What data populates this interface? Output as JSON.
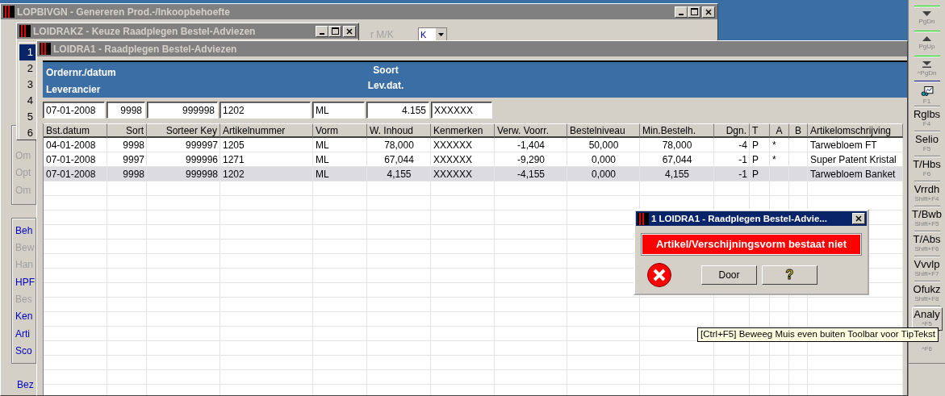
{
  "background_window": {
    "title": "LOPBIVGN - Genereren Prod.-/Inkoopbehoefte",
    "mk_label": "r M/K",
    "mk_value": "K",
    "group_1": [
      {
        "label": "Om",
        "disabled": true
      },
      {
        "label": "Opt",
        "disabled": true
      },
      {
        "label": "Om",
        "disabled": true
      }
    ],
    "group_2": [
      {
        "label": "Beh",
        "disabled": false
      },
      {
        "label": "Bew",
        "disabled": true
      },
      {
        "label": "Han",
        "disabled": true
      },
      {
        "label": "HPF",
        "disabled": false
      },
      {
        "label": "Bes",
        "disabled": true
      },
      {
        "label": "Ken",
        "disabled": false
      },
      {
        "label": "Arti",
        "disabled": false
      },
      {
        "label": "Sco",
        "disabled": false
      }
    ],
    "footer_link": {
      "label": "Bez",
      "disabled": false
    }
  },
  "choice_window": {
    "title": "LOIDRAKZ - Keuze Raadplegen Bestel-Adviezen",
    "items": [
      {
        "label": "1",
        "selected": true
      },
      {
        "label": "2",
        "selected": false
      },
      {
        "label": "3",
        "selected": false
      },
      {
        "label": "4",
        "selected": false
      },
      {
        "label": "5",
        "selected": false
      },
      {
        "label": "6",
        "selected": false
      }
    ]
  },
  "main_window": {
    "title": "LOIDRA1 - Raadplegen Bestel-Adviezen",
    "header": {
      "left": [
        "Ordernr./datum",
        "Leverancier"
      ],
      "center": [
        "Soort",
        "Lev.dat."
      ]
    },
    "filter": [
      "07-01-2008",
      "9998",
      "999998",
      "1202",
      "ML",
      "4.155",
      "XXXXXX"
    ],
    "table": {
      "columns": [
        "Bst.datum",
        "Sort",
        "Sorteer Key",
        "Artikelnummer",
        "Vorm",
        "W. Inhoud",
        "Kenmerken",
        "Verw. Voorr.",
        "Bestelniveau",
        "Min.Bestelh.",
        "Dgn.",
        "T",
        "A",
        "B",
        "Artikelomschrijving"
      ],
      "rows": [
        {
          "selected": false,
          "cells": [
            "04-01-2008",
            "9998",
            "999997",
            "1205",
            "ML",
            "78,000",
            "XXXXXX",
            "-1,404",
            "50,000",
            "78,000",
            "-4",
            "P",
            "*",
            null,
            "Tarwebloem FT"
          ]
        },
        {
          "selected": false,
          "cells": [
            "07-01-2008",
            "9997",
            "999996",
            "1271",
            "ML",
            "67,044",
            "XXXXXX",
            "-9,290",
            "0,000",
            "67,044",
            "-1",
            "P",
            "*",
            null,
            "Super Patent Kristal"
          ]
        },
        {
          "selected": true,
          "cells": [
            "07-01-2008",
            "9998",
            "999998",
            "1202",
            "ML",
            "4,155",
            "XXXXXX",
            "-4,155",
            "0,000",
            "4,155",
            "-1",
            "P",
            null,
            null,
            "Tarwebloem Banket"
          ]
        }
      ]
    }
  },
  "dialog": {
    "title": "1 LOIDRA1 - Raadplegen Bestel-Advie...",
    "message": "Artikel/Verschijningsvorm bestaat niet",
    "buttons": [
      {
        "kind": "text",
        "label": "Door"
      },
      {
        "kind": "help",
        "label": "?"
      }
    ]
  },
  "toolbar": {
    "items": [
      {
        "kind": "page_down",
        "shortcut": "PgDn"
      },
      {
        "kind": "page_up",
        "shortcut": "PgUp"
      },
      {
        "kind": "last_page",
        "shortcut": "^PgDn"
      },
      {
        "kind": "help",
        "shortcut": "F1"
      },
      {
        "kind": "text",
        "label": "Rglbs",
        "shortcut": "F4",
        "hovered": false
      },
      {
        "kind": "text",
        "label": "Selio",
        "shortcut": "F5",
        "hovered": false
      },
      {
        "kind": "text",
        "label": "T/Hbs",
        "shortcut": "F6",
        "hovered": false
      },
      {
        "kind": "text",
        "label": "Vrrdh",
        "shortcut": "Shift+F4",
        "hovered": false
      },
      {
        "kind": "text",
        "label": "T/Bwb",
        "shortcut": "Shift+F5",
        "hovered": false
      },
      {
        "kind": "text",
        "label": "T/Abs",
        "shortcut": "Shift+F6",
        "hovered": false
      },
      {
        "kind": "text",
        "label": "Vvvlp",
        "shortcut": "Shift+F7",
        "hovered": false
      },
      {
        "kind": "text",
        "label": "Ofukz",
        "shortcut": "Shift+F8",
        "hovered": false
      },
      {
        "kind": "text",
        "label": "Analy",
        "shortcut": "^F5",
        "hovered": true
      },
      {
        "kind": "text",
        "shortcut": "^F6",
        "hovered": false
      }
    ]
  },
  "tooltip": {
    "text": "[Ctrl+F5] Beweeg Muis even buiten Toolbar voor TipTekst"
  }
}
